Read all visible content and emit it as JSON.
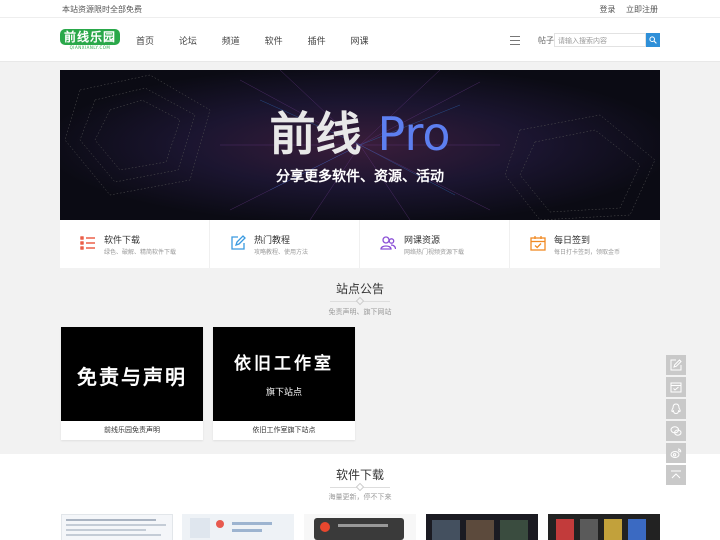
{
  "topbar": {
    "notice": "本站资源限时全部免费",
    "login": "登录",
    "register": "立即注册"
  },
  "header": {
    "logo_text": "前线乐园",
    "logo_sub": "QIANXIANLY.COM",
    "nav": [
      "首页",
      "论坛",
      "频道",
      "软件",
      "插件",
      "网课"
    ],
    "search_type": "帖子",
    "search_placeholder": "请输入搜索内容"
  },
  "banner": {
    "title_main": "前线",
    "title_accent": "Pro",
    "subtitle": "分享更多软件、资源、活动"
  },
  "features": [
    {
      "title": "软件下载",
      "desc": "绿色、破解、精简软件下载",
      "icon": "list-icon",
      "color": "#e8472e"
    },
    {
      "title": "热门教程",
      "desc": "攻略教程、使用方法",
      "icon": "edit-icon",
      "color": "#3a9ae0"
    },
    {
      "title": "网课资源",
      "desc": "网络热门视频资源下载",
      "icon": "users-icon",
      "color": "#8a4fd6"
    },
    {
      "title": "每日签到",
      "desc": "每日打卡签到，领取金币",
      "icon": "calendar-check-icon",
      "color": "#f08a24"
    }
  ],
  "announcements": {
    "title": "站点公告",
    "subtitle": "免责声明、旗下网站",
    "cards": [
      {
        "image_text": "免责与声明",
        "caption": "前线乐园免责声明"
      },
      {
        "image_text": "依旧工作室",
        "image_sub": "旗下站点",
        "caption": "依旧工作室旗下站点"
      }
    ]
  },
  "software": {
    "title": "软件下载",
    "subtitle": "海量更新，停不下来"
  },
  "side_tools": [
    "edit-icon",
    "calendar-check-icon",
    "qq-icon",
    "wechat-icon",
    "weibo-icon",
    "back-to-top-icon"
  ],
  "colors": {
    "brand_green": "#2aa84a",
    "search_blue": "#2e8fd8",
    "banner_accent": "#5d7ff0"
  }
}
